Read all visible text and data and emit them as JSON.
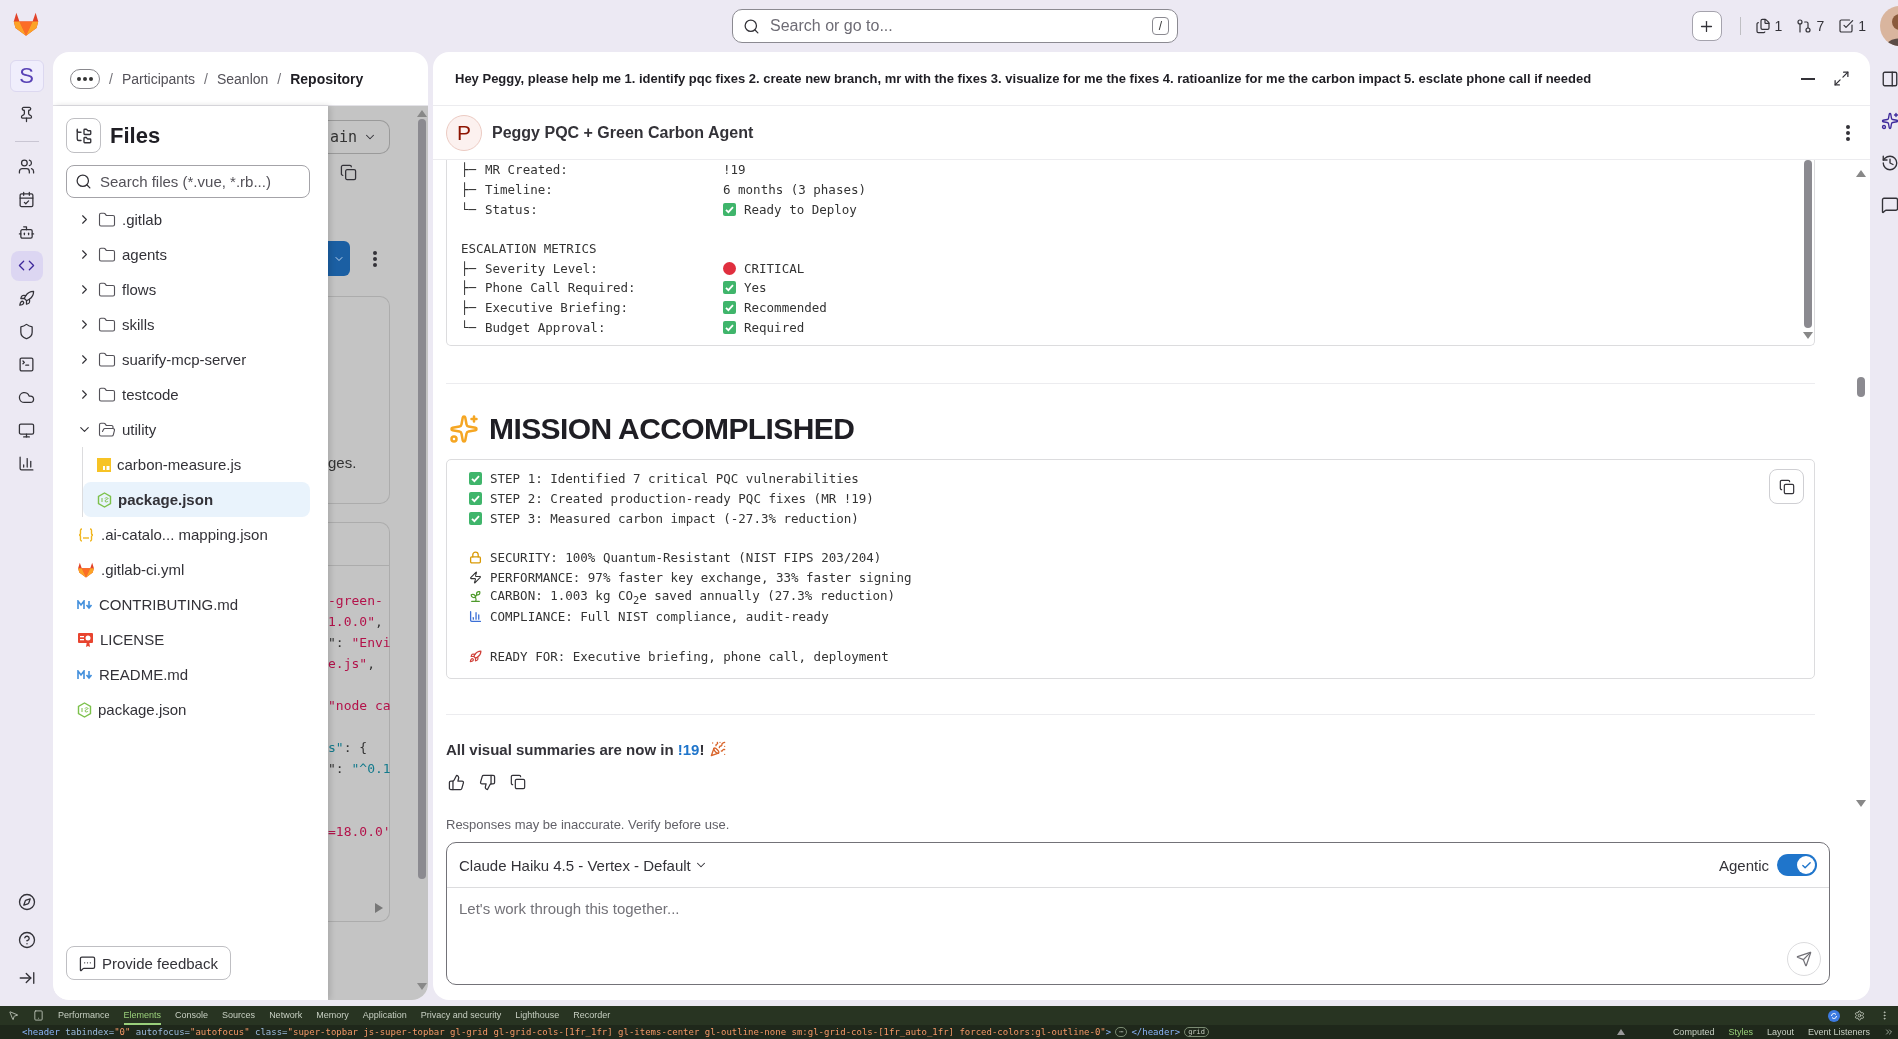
{
  "topbar": {
    "search": {
      "placeholder": "Search or go to...",
      "shortcut": "/"
    },
    "counters": [
      {
        "kind": "issues",
        "count": "1"
      },
      {
        "kind": "merge-requests",
        "count": "7"
      },
      {
        "kind": "todos",
        "count": "1"
      }
    ]
  },
  "rail": {
    "avatar": "S",
    "items": [
      {
        "kind": "pin",
        "selected": false
      },
      {
        "kind": "users",
        "selected": false
      },
      {
        "kind": "calendar",
        "selected": false
      },
      {
        "kind": "bot",
        "selected": false
      },
      {
        "kind": "code",
        "selected": true
      },
      {
        "kind": "rocket",
        "selected": false
      },
      {
        "kind": "shield",
        "selected": false
      },
      {
        "kind": "terminal",
        "selected": false
      },
      {
        "kind": "cloud",
        "selected": false
      },
      {
        "kind": "monitor",
        "selected": false
      },
      {
        "kind": "chart",
        "selected": false
      }
    ],
    "bottom": [
      {
        "kind": "compass"
      },
      {
        "kind": "help"
      },
      {
        "kind": "collapse"
      }
    ]
  },
  "breadcrumb": [
    {
      "sep": "/",
      "label": "Participants",
      "current": false
    },
    {
      "sep": "/",
      "label": "Seanlon",
      "current": false
    },
    {
      "sep": "/",
      "label": "Repository",
      "current": true
    }
  ],
  "files": {
    "title": "Files",
    "search": {
      "placeholder": "Search files (*.vue, *.rb...)"
    },
    "tree": [
      {
        "name": ".gitlab",
        "kind": "folder",
        "expanded": false
      },
      {
        "name": "agents",
        "kind": "folder",
        "expanded": false
      },
      {
        "name": "flows",
        "kind": "folder",
        "expanded": false
      },
      {
        "name": "skills",
        "kind": "folder",
        "expanded": false
      },
      {
        "name": "suarify-mcp-server",
        "kind": "folder",
        "expanded": false
      },
      {
        "name": "testcode",
        "kind": "folder",
        "expanded": false
      },
      {
        "name": "utility",
        "kind": "folder",
        "expanded": true,
        "children": [
          {
            "name": "carbon-measure.js",
            "kind": "js",
            "selected": false
          },
          {
            "name": "package.json",
            "kind": "node",
            "selected": true
          }
        ]
      },
      {
        "name": ".ai-catalo... mapping.json",
        "kind": "json",
        "selected": false
      },
      {
        "name": ".gitlab-ci.yml",
        "kind": "gitlab",
        "selected": false
      },
      {
        "name": "CONTRIBUTING.md",
        "kind": "markdown",
        "selected": false
      },
      {
        "name": "LICENSE",
        "kind": "license",
        "selected": false
      },
      {
        "name": "README.md",
        "kind": "markdown",
        "selected": false
      },
      {
        "name": "package.json",
        "kind": "node",
        "selected": false
      }
    ],
    "feedback": "Provide feedback"
  },
  "repo_behind": {
    "branch": "ain",
    "snippet": "ges.",
    "code": [
      {
        "kind": "code",
        "segments": [
          {
            "text": "-green-",
            "kind": "string"
          }
        ]
      },
      {
        "kind": "code",
        "segments": [
          {
            "text": "1.0.0\"",
            "kind": "string"
          },
          {
            "text": ",",
            "kind": "punct"
          }
        ]
      },
      {
        "kind": "code",
        "segments": [
          {
            "text": "\": ",
            "kind": "punct"
          },
          {
            "text": "\"Envi",
            "kind": "string"
          }
        ]
      },
      {
        "kind": "code",
        "segments": [
          {
            "text": "e.js\"",
            "kind": "string"
          },
          {
            "text": ",",
            "kind": "punct"
          }
        ]
      },
      {
        "kind": "blank"
      },
      {
        "kind": "code",
        "segments": [
          {
            "text": "\"node ca",
            "kind": "string"
          }
        ]
      },
      {
        "kind": "blank"
      },
      {
        "kind": "code",
        "segments": [
          {
            "text": "s\"",
            "kind": "key"
          },
          {
            "text": ": {",
            "kind": "punct"
          }
        ]
      },
      {
        "kind": "code",
        "segments": [
          {
            "text": "\": ",
            "kind": "punct"
          },
          {
            "text": "\"^0.1",
            "kind": "key"
          }
        ]
      },
      {
        "kind": "blank"
      },
      {
        "kind": "blank"
      },
      {
        "kind": "code",
        "segments": [
          {
            "text": "=18.0.0'",
            "kind": "string"
          }
        ]
      }
    ]
  },
  "chat": {
    "prompt": "Hey Peggy, please help me 1. identify pqc fixes 2. create new branch, mr with the fixes 3. visualize for me the fixes 4. ratioanlize for me the carbon impact 5. esclate phone call if needed",
    "agent": {
      "initial": "P",
      "name": "Peggy PQC + Green Carbon Agent"
    },
    "report": [
      {
        "kind": "plain",
        "branch": "├─",
        "label": "MR Created:",
        "value": "!19"
      },
      {
        "kind": "plain",
        "branch": "├─",
        "label": "Timeline:",
        "value": "6 months (3 phases)"
      },
      {
        "kind": "check",
        "branch": "└─",
        "label": "Status:",
        "value": "Ready to Deploy"
      },
      {
        "kind": "heading",
        "text": "ESCALATION METRICS"
      },
      {
        "kind": "alert",
        "branch": "├─",
        "label": "Severity Level:",
        "value": "CRITICAL"
      },
      {
        "kind": "check",
        "branch": "├─",
        "label": "Phone Call Required:",
        "value": "Yes"
      },
      {
        "kind": "check",
        "branch": "├─",
        "label": "Executive Briefing:",
        "value": "Recommended"
      },
      {
        "kind": "check",
        "branch": "└─",
        "label": "Budget Approval:",
        "value": "Required"
      }
    ],
    "mission": {
      "title": "MISSION ACCOMPLISHED",
      "lines": [
        {
          "kind": "check",
          "text": "STEP 1: Identified 7 critical PQC vulnerabilities"
        },
        {
          "kind": "check",
          "text": "STEP 2: Created production-ready PQC fixes (MR !19)"
        },
        {
          "kind": "check",
          "text": "STEP 3: Measured carbon impact (-27.3% reduction)"
        },
        {
          "kind": "blank"
        },
        {
          "kind": "lock",
          "text": "SECURITY: 100% Quantum-Resistant (NIST FIPS 203/204)"
        },
        {
          "kind": "bolt",
          "text": "PERFORMANCE: 97% faster key exchange, 33% faster signing"
        },
        {
          "kind": "seedling",
          "text": "CARBON: 1.003 kg CO$_{2}$e saved annually (27.3% reduction)"
        },
        {
          "kind": "chart",
          "text": "COMPLIANCE: Full NIST compliance, audit-ready"
        },
        {
          "kind": "blank"
        },
        {
          "kind": "rocket",
          "text": "READY FOR: Executive briefing, phone call, deployment"
        }
      ]
    },
    "summary": {
      "before": "All visual summaries are now in ",
      "link": "!19",
      "after": "!"
    },
    "disclaimer": "Responses may be inaccurate. Verify before use.",
    "composer": {
      "model": "Claude Haiku 4.5 - Vertex - Default",
      "agentic": {
        "label": "Agentic",
        "on": true
      },
      "placeholder": "Let's work through this together..."
    }
  },
  "devtools": {
    "tabs": [
      {
        "label": "Performance",
        "selected": false
      },
      {
        "label": "Elements",
        "selected": true
      },
      {
        "label": "Console",
        "selected": false
      },
      {
        "label": "Sources",
        "selected": false
      },
      {
        "label": "Network",
        "selected": false
      },
      {
        "label": "Memory",
        "selected": false
      },
      {
        "label": "Application",
        "selected": false
      },
      {
        "label": "Privacy and security",
        "selected": false
      },
      {
        "label": "Lighthouse",
        "selected": false
      },
      {
        "label": "Recorder",
        "selected": false
      }
    ],
    "source": [
      {
        "text": "<header",
        "kind": "tag"
      },
      {
        "text": " tabindex=",
        "kind": "attr"
      },
      {
        "text": "\"0\"",
        "kind": "value"
      },
      {
        "text": " autofocus=",
        "kind": "attr"
      },
      {
        "text": "\"autofocus\"",
        "kind": "value"
      },
      {
        "text": " class=",
        "kind": "attr"
      },
      {
        "text": "\"super-topbar js-super-topbar gl-grid gl-grid-cols-[1fr_1fr] gl-items-center gl-outline-none sm:gl-grid-cols-[1fr_auto_1fr] forced-colors:gl-outline-0\"",
        "kind": "value"
      },
      {
        "text": ">",
        "kind": "tag"
      }
    ],
    "ellipsis": "⋯",
    "closing": "</header>",
    "badge": "grid",
    "panes": [
      {
        "label": "Computed",
        "selected": false
      },
      {
        "label": "Styles",
        "selected": true
      },
      {
        "label": "Layout",
        "selected": false
      },
      {
        "label": "Event Listeners",
        "selected": false
      }
    ]
  }
}
